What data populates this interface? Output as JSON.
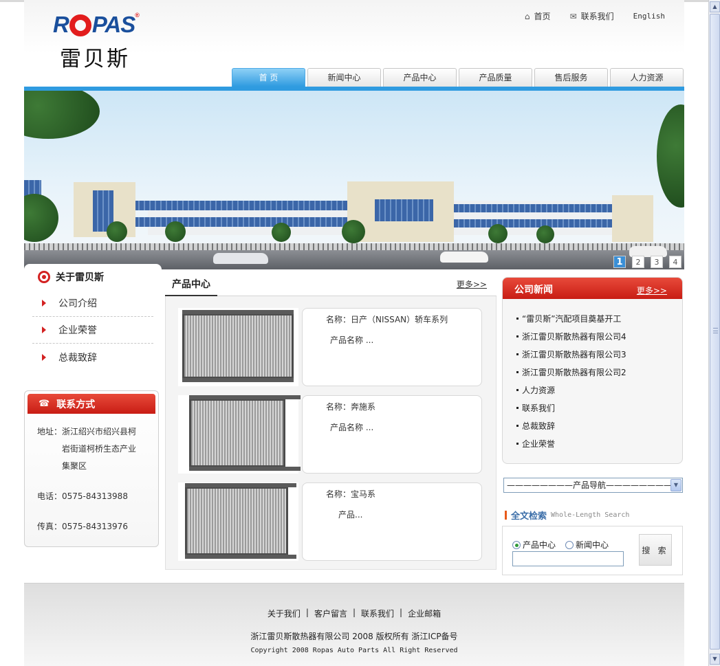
{
  "header": {
    "logo_en_left": "R",
    "logo_en_right": "PAS",
    "logo_reg": "®",
    "logo_cn": "雷贝斯",
    "top_links": {
      "home": "首页",
      "contact": "联系我们",
      "english": "English"
    }
  },
  "nav": {
    "tabs": [
      {
        "label": "首 页",
        "active": true
      },
      {
        "label": "新闻中心",
        "active": false
      },
      {
        "label": "产品中心",
        "active": false
      },
      {
        "label": "产品质量",
        "active": false
      },
      {
        "label": "售后服务",
        "active": false
      },
      {
        "label": "人力资源",
        "active": false
      }
    ]
  },
  "banner": {
    "slides": [
      "1",
      "2",
      "3",
      "4"
    ],
    "active_slide": "1"
  },
  "about": {
    "title": "关于雷贝斯",
    "items": [
      "公司介绍",
      "企业荣誉",
      "总裁致辞"
    ]
  },
  "contact": {
    "title": "联系方式",
    "address_label": "地址：",
    "address_value": "浙江绍兴市绍兴县柯岩街道柯桥生态产业集聚区",
    "phone": "电话：0575-84313988",
    "fax": "传真：0575-84313976"
  },
  "products": {
    "title": "产品中心",
    "more": "更多>>",
    "items": [
      {
        "name": "名称：日产（NISSAN）轿车系列",
        "desc": "产品名称 ..."
      },
      {
        "name": "名称：奔施系",
        "desc": "产品名称 ..."
      },
      {
        "name": "名称：宝马系",
        "desc": "产品..."
      }
    ]
  },
  "news": {
    "title": "公司新闻",
    "more": "更多>>",
    "items": [
      "“雷贝斯”汽配项目奠基开工",
      "浙江雷贝斯散热器有限公司4",
      "浙江雷贝斯散热器有限公司3",
      "浙江雷贝斯散热器有限公司2",
      "人力资源",
      "联系我们",
      "总裁致辞",
      "企业荣誉"
    ]
  },
  "product_nav": {
    "selected": "————————产品导航————————"
  },
  "search": {
    "title_cn": "全文检索",
    "title_en": "Whole-Length Search",
    "options": [
      "产品中心",
      "新闻中心"
    ],
    "checked": "产品中心",
    "input_value": "",
    "button": "搜 索"
  },
  "footer": {
    "links": [
      "关于我们",
      "客户留言",
      "联系我们",
      "企业邮箱"
    ],
    "separator": "|",
    "copyright_cn": "浙江雷贝斯散热器有限公司 2008 版权所有 浙江ICP备号",
    "copyright_en": "Copyright 2008 Ropas Auto Parts All Right Reserved"
  },
  "colors": {
    "brand_blue": "#1a4f9c",
    "brand_red": "#d32222",
    "nav_active": "#2f9be0"
  }
}
